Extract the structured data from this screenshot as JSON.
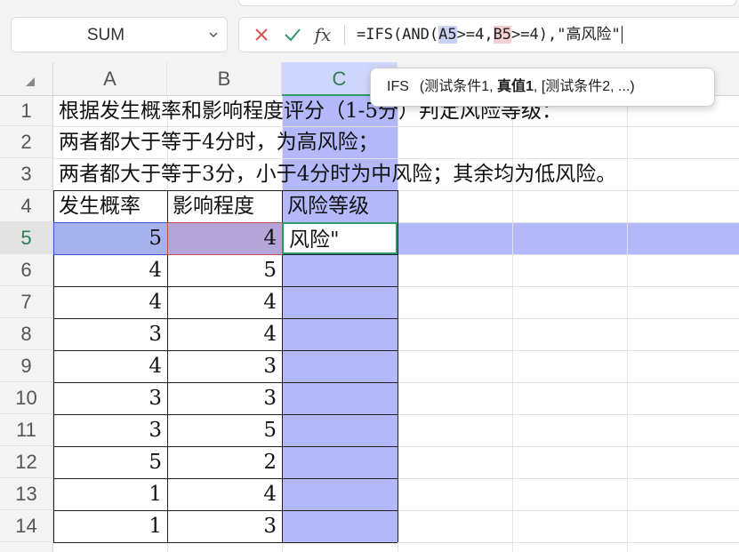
{
  "name_box": {
    "value": "SUM"
  },
  "formula_bar": {
    "prefix": "=IFS(AND(",
    "ref_a": "A5",
    "mid1": ">=4,",
    "ref_b": "B5",
    "mid2": ">=4),\"高风险\""
  },
  "tooltip": {
    "fn_name": "IFS",
    "open": "(测试条件1, ",
    "bold_arg": "真值1",
    "rest": ", [测试条件2, ...)"
  },
  "columns": [
    "A",
    "B",
    "C"
  ],
  "rows": [
    "1",
    "2",
    "3",
    "4",
    "5",
    "6",
    "7",
    "8",
    "9",
    "10",
    "11",
    "12",
    "13",
    "14"
  ],
  "sheet": {
    "notes": [
      "根据发生概率和影响程度评分（1-5分）判定风险等级：",
      "两者都大于等于4分时，为高风险；",
      "两者都大于等于3分，小于4分时为中风险；其余均为低风险。"
    ],
    "headers": [
      "发生概率",
      "影响程度",
      "风险等级"
    ],
    "editing_text": "风险\"",
    "data": [
      [
        "5",
        "4"
      ],
      [
        "4",
        "5"
      ],
      [
        "4",
        "4"
      ],
      [
        "3",
        "4"
      ],
      [
        "4",
        "3"
      ],
      [
        "3",
        "3"
      ],
      [
        "3",
        "5"
      ],
      [
        "5",
        "2"
      ],
      [
        "1",
        "4"
      ],
      [
        "1",
        "3"
      ]
    ]
  },
  "colors": {
    "selection": "#b3b8fb",
    "ref_a": "#a6b2ee",
    "ref_b": "#b5a6d9",
    "active_border": "#2f9a6b"
  }
}
